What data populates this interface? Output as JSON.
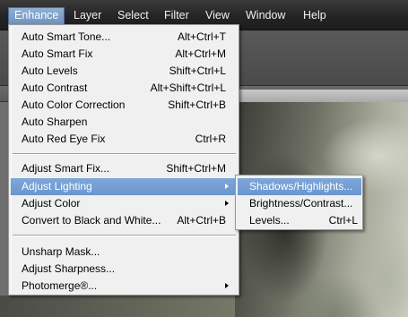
{
  "menubar": {
    "items": [
      {
        "label": "Enhance",
        "active": true
      },
      {
        "label": "Layer"
      },
      {
        "label": "Select"
      },
      {
        "label": "Filter"
      },
      {
        "label": "View"
      },
      {
        "label": "Window"
      },
      {
        "label": "Help"
      }
    ]
  },
  "enhance_menu": {
    "items": [
      {
        "label": "Auto Smart Tone...",
        "shortcut": "Alt+Ctrl+T"
      },
      {
        "label": "Auto Smart Fix",
        "shortcut": "Alt+Ctrl+M"
      },
      {
        "label": "Auto Levels",
        "shortcut": "Shift+Ctrl+L"
      },
      {
        "label": "Auto Contrast",
        "shortcut": "Alt+Shift+Ctrl+L"
      },
      {
        "label": "Auto Color Correction",
        "shortcut": "Shift+Ctrl+B"
      },
      {
        "label": "Auto Sharpen",
        "shortcut": ""
      },
      {
        "label": "Auto Red Eye Fix",
        "shortcut": "Ctrl+R"
      },
      {
        "label": "Adjust Smart Fix...",
        "shortcut": "Shift+Ctrl+M"
      },
      {
        "label": "Adjust Lighting",
        "shortcut": "",
        "submenu": true,
        "highlighted": true
      },
      {
        "label": "Adjust Color",
        "shortcut": "",
        "submenu": true
      },
      {
        "label": "Convert to Black and White...",
        "shortcut": "Alt+Ctrl+B"
      },
      {
        "label": "Unsharp Mask...",
        "shortcut": ""
      },
      {
        "label": "Adjust Sharpness...",
        "shortcut": ""
      },
      {
        "label": "Photomerge®...",
        "shortcut": "",
        "submenu": true
      }
    ]
  },
  "lighting_submenu": {
    "items": [
      {
        "label": "Shadows/Highlights...",
        "shortcut": "",
        "highlighted": true
      },
      {
        "label": "Brightness/Contrast...",
        "shortcut": ""
      },
      {
        "label": "Levels...",
        "shortcut": "Ctrl+L"
      }
    ]
  },
  "colors": {
    "menubar_bg": "#242424",
    "menu_bg": "#f0f0f0",
    "highlight": "#7298d0",
    "text": "#000000",
    "highlight_text": "#ffffff"
  },
  "icons": {
    "submenu_arrow": "chevron-right-icon"
  }
}
